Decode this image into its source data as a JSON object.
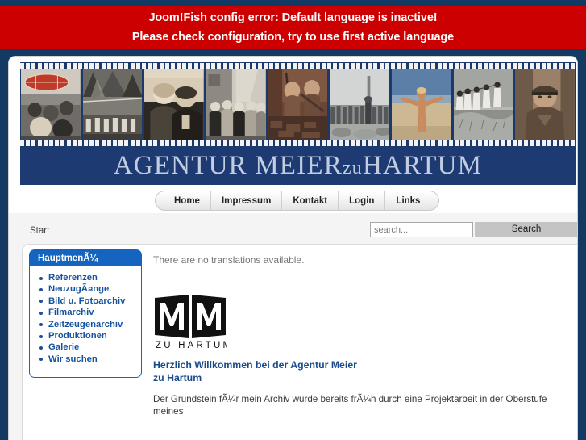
{
  "error_banner": {
    "line1": "Joom!Fish config error: Default language is inactive!",
    "line2": "Please check configuration, try to use first active language",
    "bg_color": "#cc0000",
    "text_color": "#ffffff"
  },
  "header": {
    "logo_text_main": "AGENTUR  MEIER",
    "logo_text_zu": "zu",
    "logo_text_end": "HARTUM",
    "logo_full": "AGENTUR MEIERzuHARTUM",
    "logo_bg_color": "#1e3a73",
    "logo_text_color": "#c3cde0",
    "filmstrip_bg_color": "#1b3a6b",
    "photos": [
      {
        "name": "photo-fairground-parasol",
        "tone": "color-vintage"
      },
      {
        "name": "photo-tents-gathering",
        "tone": "black-white"
      },
      {
        "name": "photo-couple-portrait",
        "tone": "sepia"
      },
      {
        "name": "photo-wedding-group",
        "tone": "black-white"
      },
      {
        "name": "photo-workers-rubble",
        "tone": "color-vintage"
      },
      {
        "name": "photo-soldiers-formation",
        "tone": "black-white"
      },
      {
        "name": "photo-beach-figure",
        "tone": "color-vintage"
      },
      {
        "name": "photo-dancers-dunes",
        "tone": "black-white"
      },
      {
        "name": "photo-officer-portrait",
        "tone": "sepia"
      }
    ]
  },
  "nav": {
    "items": [
      {
        "label": "Home"
      },
      {
        "label": "Impressum"
      },
      {
        "label": "Kontakt"
      },
      {
        "label": "Login"
      },
      {
        "label": "Links"
      }
    ]
  },
  "toolbar": {
    "breadcrumb": "Start",
    "search_value": "",
    "search_placeholder": "search...",
    "search_button_label": "Search",
    "search_button_color": "#c4c4c4"
  },
  "sidebar": {
    "title": "HauptmenÃ¼",
    "header_color": "#1565c0",
    "link_color": "#15539e",
    "items": [
      {
        "label": "Referenzen"
      },
      {
        "label": "NeuzugÃ¤nge"
      },
      {
        "label": "Bild u. Fotoarchiv"
      },
      {
        "label": "Filmarchiv"
      },
      {
        "label": "Zeitzeugenarchiv"
      },
      {
        "label": "Produktionen"
      },
      {
        "label": "Galerie"
      },
      {
        "label": "Wir suchen"
      }
    ]
  },
  "content": {
    "no_translations": "There are no translations available.",
    "mm_logo_mark": "MM",
    "mm_logo_sub": "ZU HARTUM",
    "heading": "Herzlich Willkommen bei der Agentur Meier zu Hartum",
    "heading_color": "#1a4a8a",
    "paragraph": "Der Grundstein fÃ¼r mein Archiv wurde bereits frÃ¼h durch eine Projektarbeit in der Oberstufe meines"
  }
}
